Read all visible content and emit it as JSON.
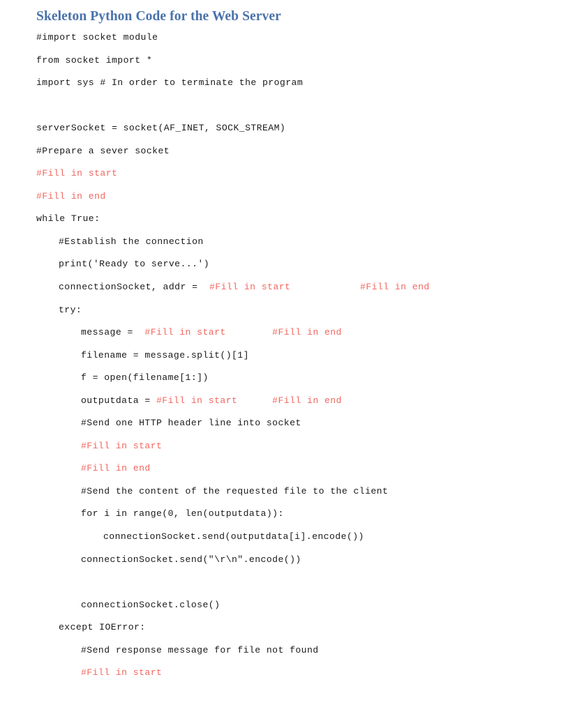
{
  "document": {
    "title": "Skeleton Python Code for the Web Server",
    "title_color": "#4a72ab",
    "code_color": "#1a1a1a",
    "fill_marker_color": "#f2665e",
    "background_color": "#ffffff"
  },
  "code": {
    "lines": [
      {
        "indent": 0,
        "segments": [
          {
            "kind": "plain",
            "text": "#import socket module"
          }
        ]
      },
      {
        "indent": 0,
        "segments": [
          {
            "kind": "plain",
            "text": "from socket import *"
          }
        ]
      },
      {
        "indent": 0,
        "segments": [
          {
            "kind": "plain",
            "text": "import sys # In order to terminate the program"
          }
        ]
      },
      {
        "indent": 0,
        "segments": [
          {
            "kind": "plain",
            "text": ""
          }
        ]
      },
      {
        "indent": 0,
        "segments": [
          {
            "kind": "plain",
            "text": "serverSocket = socket(AF_INET, SOCK_STREAM)"
          }
        ]
      },
      {
        "indent": 0,
        "segments": [
          {
            "kind": "plain",
            "text": "#Prepare a sever socket"
          }
        ]
      },
      {
        "indent": 0,
        "segments": [
          {
            "kind": "fill",
            "text": "#Fill in start"
          }
        ]
      },
      {
        "indent": 0,
        "segments": [
          {
            "kind": "fill",
            "text": "#Fill in end"
          }
        ]
      },
      {
        "indent": 0,
        "segments": [
          {
            "kind": "plain",
            "text": "while True:"
          }
        ]
      },
      {
        "indent": 1,
        "segments": [
          {
            "kind": "plain",
            "text": "#Establish the connection"
          }
        ]
      },
      {
        "indent": 1,
        "segments": [
          {
            "kind": "plain",
            "text": "print('Ready to serve...')"
          }
        ]
      },
      {
        "indent": 1,
        "segments": [
          {
            "kind": "plain",
            "text": "connectionSocket, addr =  "
          },
          {
            "kind": "fill",
            "text": "#Fill in start"
          },
          {
            "kind": "plain",
            "text": "            "
          },
          {
            "kind": "fill",
            "text": "#Fill in end"
          }
        ]
      },
      {
        "indent": 1,
        "segments": [
          {
            "kind": "plain",
            "text": "try:"
          }
        ]
      },
      {
        "indent": 2,
        "segments": [
          {
            "kind": "plain",
            "text": "message =  "
          },
          {
            "kind": "fill",
            "text": "#Fill in start"
          },
          {
            "kind": "plain",
            "text": "        "
          },
          {
            "kind": "fill",
            "text": "#Fill in end"
          }
        ]
      },
      {
        "indent": 2,
        "segments": [
          {
            "kind": "plain",
            "text": "filename = message.split()[1]"
          }
        ]
      },
      {
        "indent": 2,
        "segments": [
          {
            "kind": "plain",
            "text": "f = open(filename[1:])"
          }
        ]
      },
      {
        "indent": 2,
        "segments": [
          {
            "kind": "plain",
            "text": "outputdata = "
          },
          {
            "kind": "fill",
            "text": "#Fill in start"
          },
          {
            "kind": "plain",
            "text": "      "
          },
          {
            "kind": "fill",
            "text": "#Fill in end"
          }
        ]
      },
      {
        "indent": 2,
        "segments": [
          {
            "kind": "plain",
            "text": "#Send one HTTP header line into socket"
          }
        ]
      },
      {
        "indent": 2,
        "segments": [
          {
            "kind": "fill",
            "text": "#Fill in start"
          }
        ]
      },
      {
        "indent": 2,
        "segments": [
          {
            "kind": "fill",
            "text": "#Fill in end"
          }
        ]
      },
      {
        "indent": 2,
        "segments": [
          {
            "kind": "plain",
            "text": "#Send the content of the requested file to the client"
          }
        ]
      },
      {
        "indent": 2,
        "segments": [
          {
            "kind": "plain",
            "text": "for i in range(0, len(outputdata)):"
          }
        ]
      },
      {
        "indent": 3,
        "segments": [
          {
            "kind": "plain",
            "text": "connectionSocket.send(outputdata[i].encode())"
          }
        ]
      },
      {
        "indent": 2,
        "segments": [
          {
            "kind": "plain",
            "text": "connectionSocket.send(\"\\r\\n\".encode())"
          }
        ]
      },
      {
        "indent": 0,
        "segments": [
          {
            "kind": "plain",
            "text": ""
          }
        ]
      },
      {
        "indent": 2,
        "segments": [
          {
            "kind": "plain",
            "text": "connectionSocket.close()"
          }
        ]
      },
      {
        "indent": 1,
        "segments": [
          {
            "kind": "plain",
            "text": "except IOError:"
          }
        ]
      },
      {
        "indent": 2,
        "segments": [
          {
            "kind": "plain",
            "text": "#Send response message for file not found"
          }
        ]
      },
      {
        "indent": 2,
        "segments": [
          {
            "kind": "fill",
            "text": "#Fill in start"
          }
        ]
      }
    ]
  }
}
